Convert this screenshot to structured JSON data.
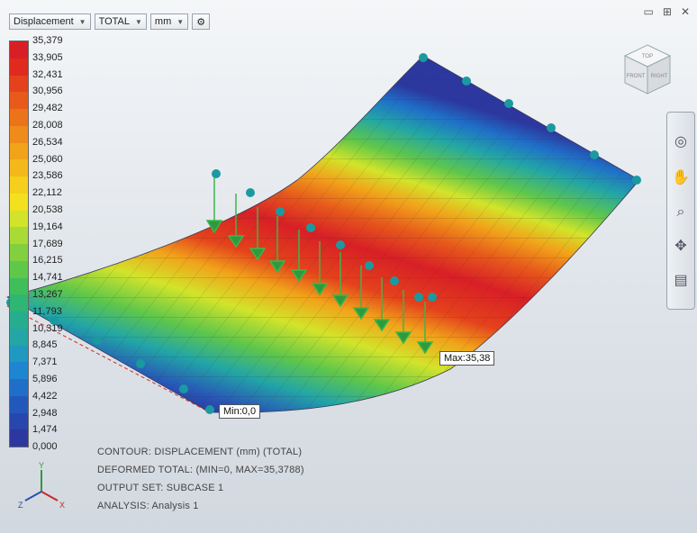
{
  "toolbar": {
    "result_type": "Displacement",
    "component": "TOTAL",
    "unit": "mm",
    "settings_icon": "gear-icon"
  },
  "window_controls": {
    "restore": "▭",
    "maximize": "⊞",
    "close": "✕"
  },
  "legend": {
    "labels": [
      "35,379",
      "33,905",
      "32,431",
      "30,956",
      "29,482",
      "28,008",
      "26,534",
      "25,060",
      "23,586",
      "22,112",
      "20,538",
      "19,164",
      "17,689",
      "16,215",
      "14,741",
      "13,267",
      "11,793",
      "10,319",
      "8,845",
      "7,371",
      "5,896",
      "4,422",
      "2,948",
      "1,474",
      "0,000"
    ],
    "colors": [
      "#d81f26",
      "#e02a1d",
      "#e4421c",
      "#e75a1b",
      "#eb731a",
      "#ee8b1a",
      "#f1a31a",
      "#f3b81a",
      "#f5cf1b",
      "#f3e11d",
      "#d2e42a",
      "#a8db36",
      "#82d03f",
      "#5fc74a",
      "#3fbe5a",
      "#2fb574",
      "#26ad8e",
      "#22a6a6",
      "#1f99bf",
      "#1e86d0",
      "#1f6fc9",
      "#2258bc",
      "#2746ae",
      "#2c389f"
    ]
  },
  "callouts": {
    "max": "Max:35,38",
    "min": "Min:0,0"
  },
  "info": {
    "line1": "CONTOUR: DISPLACEMENT (mm) (TOTAL)",
    "line2": "DEFORMED TOTAL: (MIN=0, MAX=35,3788)",
    "line3": "OUTPUT SET: SUBCASE 1",
    "line4": "ANALYSIS: Analysis 1"
  },
  "viewcube": {
    "top": "TOP",
    "front": "FRONT",
    "right": "RIGHT"
  },
  "triad": {
    "x": "X",
    "y": "Y",
    "z": "Z"
  },
  "navbar_icons": [
    "steering-wheel-icon",
    "pan-hand-icon",
    "zoom-icon",
    "orbit-icon",
    "look-at-icon"
  ],
  "colors": {
    "accent": "#1f99bf",
    "max_color": "#d81f26",
    "min_color": "#2c389f",
    "load_arrow": "#3cb64a",
    "constraint": "#1a9aa0"
  }
}
